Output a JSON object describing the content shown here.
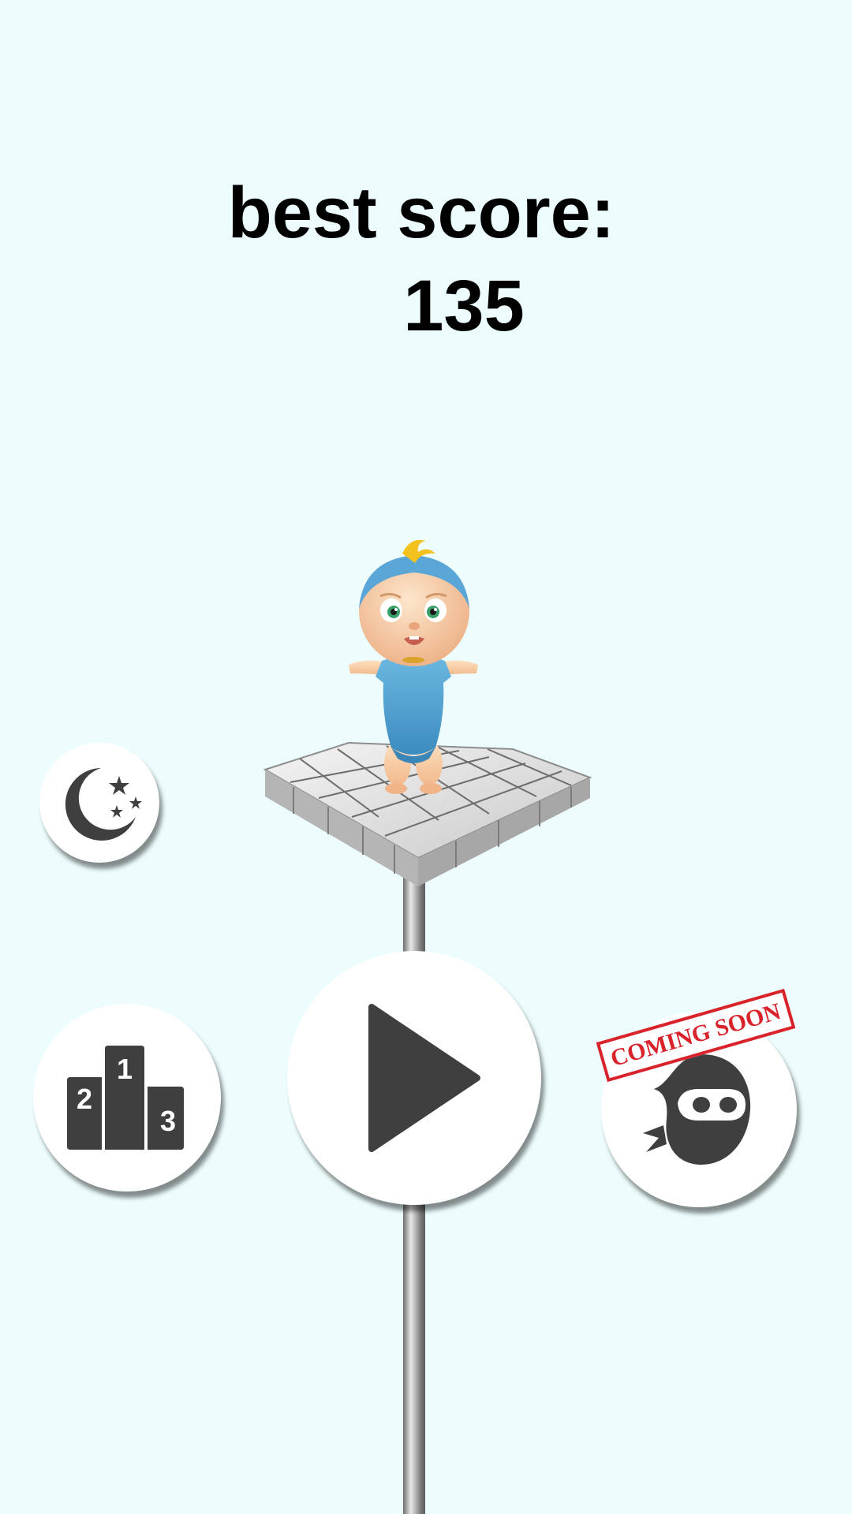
{
  "score": {
    "label": "best score:",
    "value": "135"
  },
  "buttons": {
    "night_mode_icon": "moon-stars-icon",
    "leaderboard_icon": "podium-icon",
    "leaderboard_places": [
      "1",
      "2",
      "3"
    ],
    "play_icon": "play-icon",
    "character_icon": "ninja-icon",
    "character_badge": "COMING SOON"
  },
  "colors": {
    "background": "#edfdfd",
    "icon_dark": "#3f3f3f",
    "badge_red": "#d8232a"
  }
}
